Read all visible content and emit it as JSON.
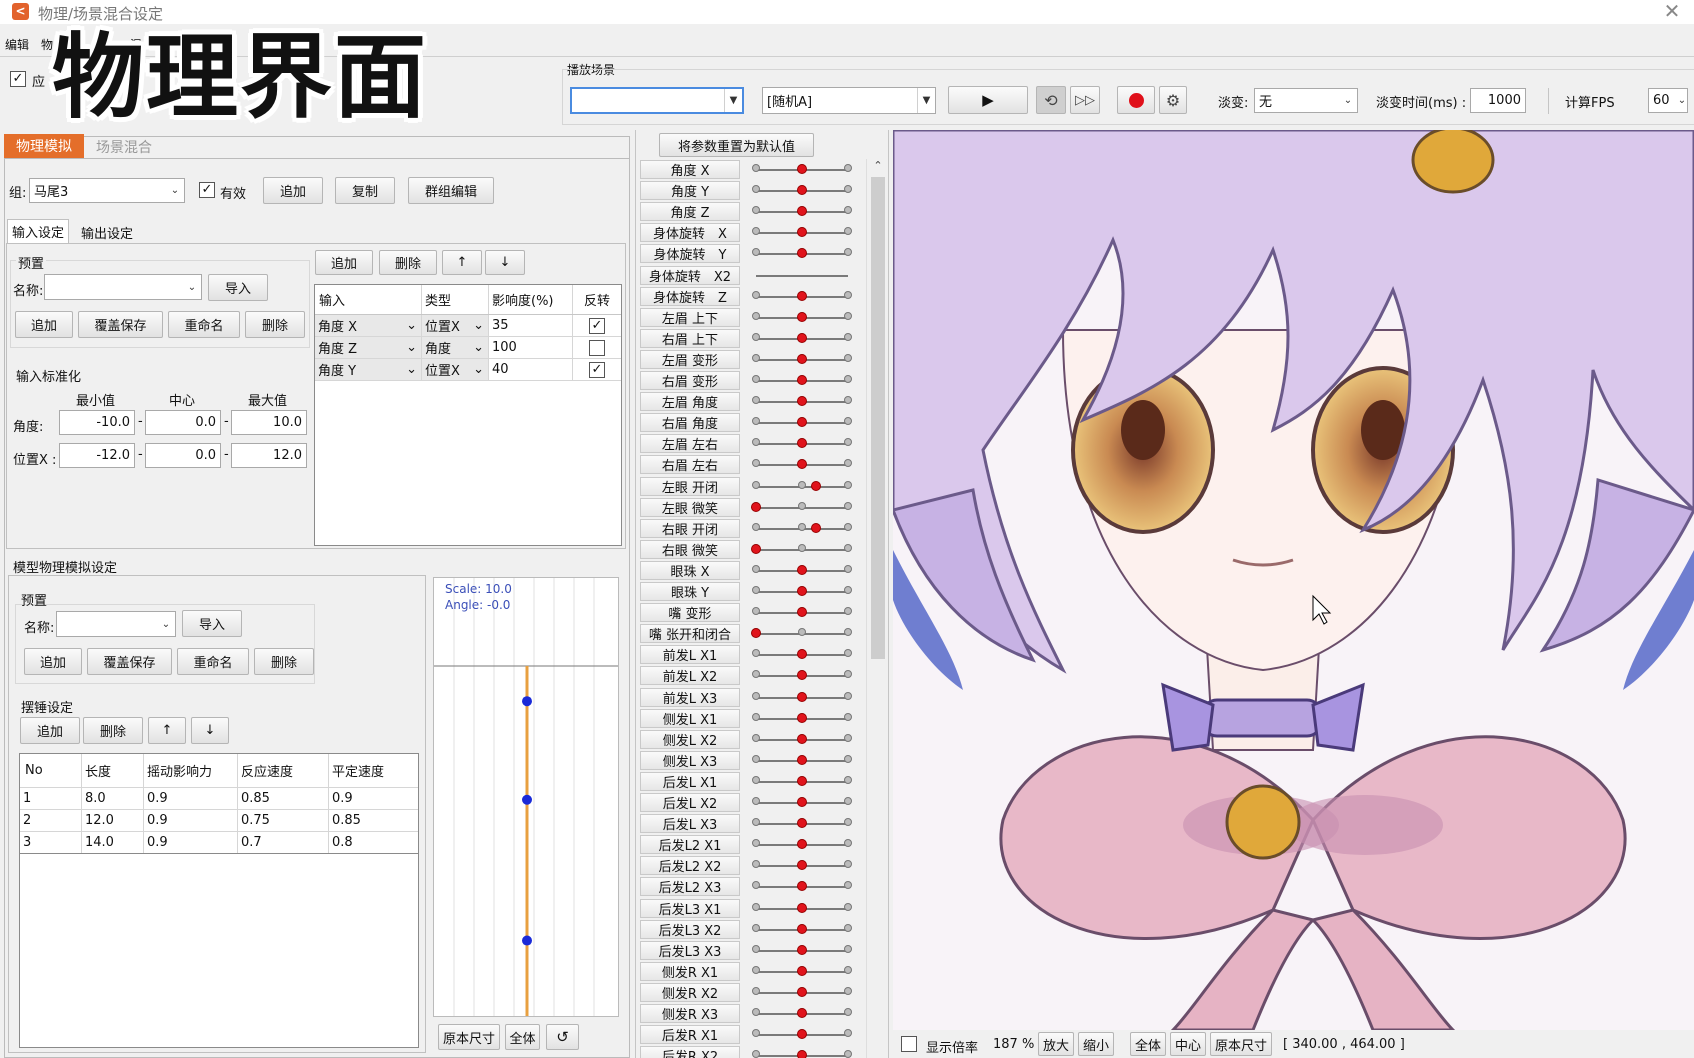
{
  "window": {
    "title": "物理/场景混合设定"
  },
  "menu": {
    "items": [
      "编辑",
      "物",
      "混合"
    ]
  },
  "overlay_title": "物理界面",
  "toolbar": {
    "apply_checkbox_label": "应",
    "scene_group_label": "播放场景",
    "scene_select": "",
    "random_select": "[随机A]",
    "fade_label": "淡变:",
    "fade_value": "无",
    "fade_time_label": "淡变时间(ms) :",
    "fade_time_value": "1000",
    "fps_label": "计算FPS",
    "fps_value": "60"
  },
  "left_tabs": {
    "physics": "物理模拟",
    "scene": "场景混合"
  },
  "group": {
    "label": "组:",
    "value": "马尾3",
    "valid_label": "有效",
    "add": "追加",
    "copy": "复制",
    "group_edit": "群组编辑"
  },
  "io_tabs": {
    "input": "输入设定",
    "output": "输出设定"
  },
  "preset": {
    "title": "预置",
    "name_label": "名称:",
    "import": "导入",
    "add": "追加",
    "overwrite": "覆盖保存",
    "rename": "重命名",
    "delete": "删除"
  },
  "normalize": {
    "title": "输入标准化",
    "min_label": "最小值",
    "center_label": "中心",
    "max_label": "最大值",
    "angle_label": "角度:",
    "angle_min": "-10.0",
    "angle_center": "0.0",
    "angle_max": "10.0",
    "pos_label": "位置X :",
    "pos_min": "-12.0",
    "pos_center": "0.0",
    "pos_max": "12.0"
  },
  "input_table": {
    "add": "追加",
    "delete": "删除",
    "up": "↑",
    "down": "↓",
    "headers": [
      "输入",
      "类型",
      "影响度(%)",
      "反转"
    ],
    "rows": [
      {
        "input": "角度 X",
        "type": "位置X",
        "influence": "35",
        "invert": true
      },
      {
        "input": "角度 Z",
        "type": "角度",
        "influence": "100",
        "invert": false
      },
      {
        "input": "角度 Y",
        "type": "位置X",
        "influence": "40",
        "invert": true
      }
    ]
  },
  "model_physics": {
    "title": "模型物理模拟设定",
    "preset_title": "预置",
    "name_label": "名称:",
    "import": "导入",
    "add": "追加",
    "overwrite": "覆盖保存",
    "rename": "重命名",
    "delete": "删除",
    "pendulum_title": "摆锤设定",
    "p_add": "追加",
    "p_delete": "删除",
    "p_up": "↑",
    "p_down": "↓",
    "headers": [
      "No",
      "长度",
      "摇动影响力",
      "反应速度",
      "平定速度"
    ],
    "rows": [
      [
        "1",
        "8.0",
        "0.9",
        "0.85",
        "0.9"
      ],
      [
        "2",
        "12.0",
        "0.9",
        "0.75",
        "0.85"
      ],
      [
        "3",
        "14.0",
        "0.9",
        "0.7",
        "0.8"
      ]
    ]
  },
  "pendulum_view": {
    "scale": "Scale: 10.0",
    "angle": "Angle: -0.0",
    "original_size": "原本尺寸",
    "fit_all": "全体",
    "points": [
      0.1,
      0.38,
      0.78
    ]
  },
  "params": {
    "reset_button": "将参数重置为默认值",
    "items": [
      {
        "label": "角度 X",
        "value": 0.5
      },
      {
        "label": "角度 Y",
        "value": 0.5
      },
      {
        "label": "角度 Z",
        "value": 0.5
      },
      {
        "label": "身体旋转　X",
        "value": 0.5
      },
      {
        "label": "身体旋转　Y",
        "value": 0.5
      },
      {
        "label": "身体旋转　X2",
        "value": null
      },
      {
        "label": "身体旋转　Z",
        "value": 0.5
      },
      {
        "label": "左眉 上下",
        "value": 0.5
      },
      {
        "label": "右眉 上下",
        "value": 0.5
      },
      {
        "label": "左眉 变形",
        "value": 0.5
      },
      {
        "label": "右眉 变形",
        "value": 0.5
      },
      {
        "label": "左眉 角度",
        "value": 0.5
      },
      {
        "label": "右眉 角度",
        "value": 0.5
      },
      {
        "label": "左眉 左右",
        "value": 0.5
      },
      {
        "label": "右眉 左右",
        "value": 0.5
      },
      {
        "label": "左眼 开闭",
        "value": 0.65
      },
      {
        "label": "左眼 微笑",
        "value": 0.0
      },
      {
        "label": "右眼 开闭",
        "value": 0.65
      },
      {
        "label": "右眼 微笑",
        "value": 0.0
      },
      {
        "label": "眼珠 X",
        "value": 0.5
      },
      {
        "label": "眼珠 Y",
        "value": 0.5
      },
      {
        "label": "嘴 变形",
        "value": 0.5
      },
      {
        "label": "嘴 张开和闭合",
        "value": 0.0
      },
      {
        "label": "前发L X1",
        "value": 0.5
      },
      {
        "label": "前发L X2",
        "value": 0.5
      },
      {
        "label": "前发L X3",
        "value": 0.5
      },
      {
        "label": "侧发L X1",
        "value": 0.5
      },
      {
        "label": "侧发L X2",
        "value": 0.5
      },
      {
        "label": "侧发L X3",
        "value": 0.5
      },
      {
        "label": "后发L X1",
        "value": 0.5
      },
      {
        "label": "后发L X2",
        "value": 0.5
      },
      {
        "label": "后发L X3",
        "value": 0.5
      },
      {
        "label": "后发L2 X1",
        "value": 0.5
      },
      {
        "label": "后发L2 X2",
        "value": 0.5
      },
      {
        "label": "后发L2 X3",
        "value": 0.5
      },
      {
        "label": "后发L3 X1",
        "value": 0.5
      },
      {
        "label": "后发L3 X2",
        "value": 0.5
      },
      {
        "label": "后发L3 X3",
        "value": 0.5
      },
      {
        "label": "侧发R X1",
        "value": 0.5
      },
      {
        "label": "侧发R X2",
        "value": 0.5
      },
      {
        "label": "侧发R X3",
        "value": 0.5
      },
      {
        "label": "后发R X1",
        "value": 0.5
      },
      {
        "label": "后发R X2",
        "value": 0.5
      }
    ]
  },
  "viewer_status": {
    "show_zoom_label": "显示倍率",
    "zoom": "187 %",
    "zoom_in": "放大",
    "zoom_out": "缩小",
    "fit": "全体",
    "center": "中心",
    "original": "原本尺寸",
    "coords": "[ 340.00 , 464.00 ]"
  }
}
